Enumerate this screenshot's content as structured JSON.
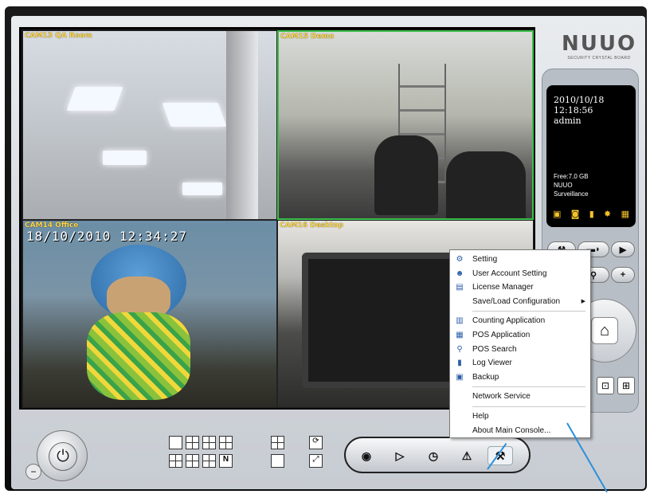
{
  "brand": {
    "logo": "NUUO",
    "tagline": "SECURITY CRYSTAL BOARD"
  },
  "cameras": [
    {
      "label": "CAM13 QA Room"
    },
    {
      "label": "CAM15 Demo"
    },
    {
      "label": "CAM14 Office",
      "timestamp": "18/10/2010 12:34:27"
    },
    {
      "label": "CAM16 Desktop"
    }
  ],
  "status_panel": {
    "date": "2010/10/18",
    "time": "12:18:56",
    "user": "admin",
    "free": "Free:7.0 GB",
    "brand": "NUUO",
    "product": "Surveillance"
  },
  "menu": {
    "items": [
      {
        "label": "Setting",
        "icon": "gear-icon"
      },
      {
        "label": "User Account Setting",
        "icon": "user-icon"
      },
      {
        "label": "License Manager",
        "icon": "license-icon"
      },
      {
        "label": "Save/Load Configuration",
        "submenu": true
      },
      {
        "label": "Counting Application",
        "icon": "counting-icon"
      },
      {
        "label": "POS Application",
        "icon": "pos-icon"
      },
      {
        "label": "POS Search",
        "icon": "pos-search-icon"
      },
      {
        "label": "Log Viewer",
        "icon": "log-icon"
      },
      {
        "label": "Backup",
        "icon": "backup-icon"
      },
      {
        "label": "Network Service"
      },
      {
        "label": "Help"
      },
      {
        "label": "About Main Console..."
      }
    ]
  },
  "colors": {
    "selected_border": "#3bbf4a",
    "camera_label": "#ffd84a",
    "callout": "#2d8fd9",
    "layout_active": "#4aa3e6"
  }
}
